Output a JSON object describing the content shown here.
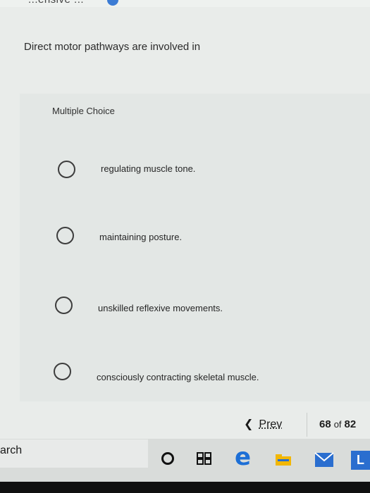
{
  "header": {
    "fragment_text": "...ensive ..."
  },
  "question": {
    "text": "Direct motor pathways are involved in"
  },
  "question_type": "Multiple Choice",
  "options": [
    {
      "label": "regulating muscle tone."
    },
    {
      "label": "maintaining posture."
    },
    {
      "label": "unskilled reflexive movements."
    },
    {
      "label": "consciously contracting skeletal muscle."
    }
  ],
  "navigation": {
    "prev_label": "Prev",
    "current_page": "68",
    "of_label": "of",
    "total_pages": "82"
  },
  "taskbar": {
    "search_fragment": "arch",
    "launcher_letter": "L",
    "icons": [
      "cortana-icon",
      "task-view-icon",
      "edge-browser-icon",
      "file-explorer-icon",
      "mail-icon",
      "launcher-icon"
    ]
  },
  "colors": {
    "accent_blue": "#2a6ecf",
    "explorer_yellow": "#f2b705",
    "edge_blue": "#1d6fd6"
  }
}
